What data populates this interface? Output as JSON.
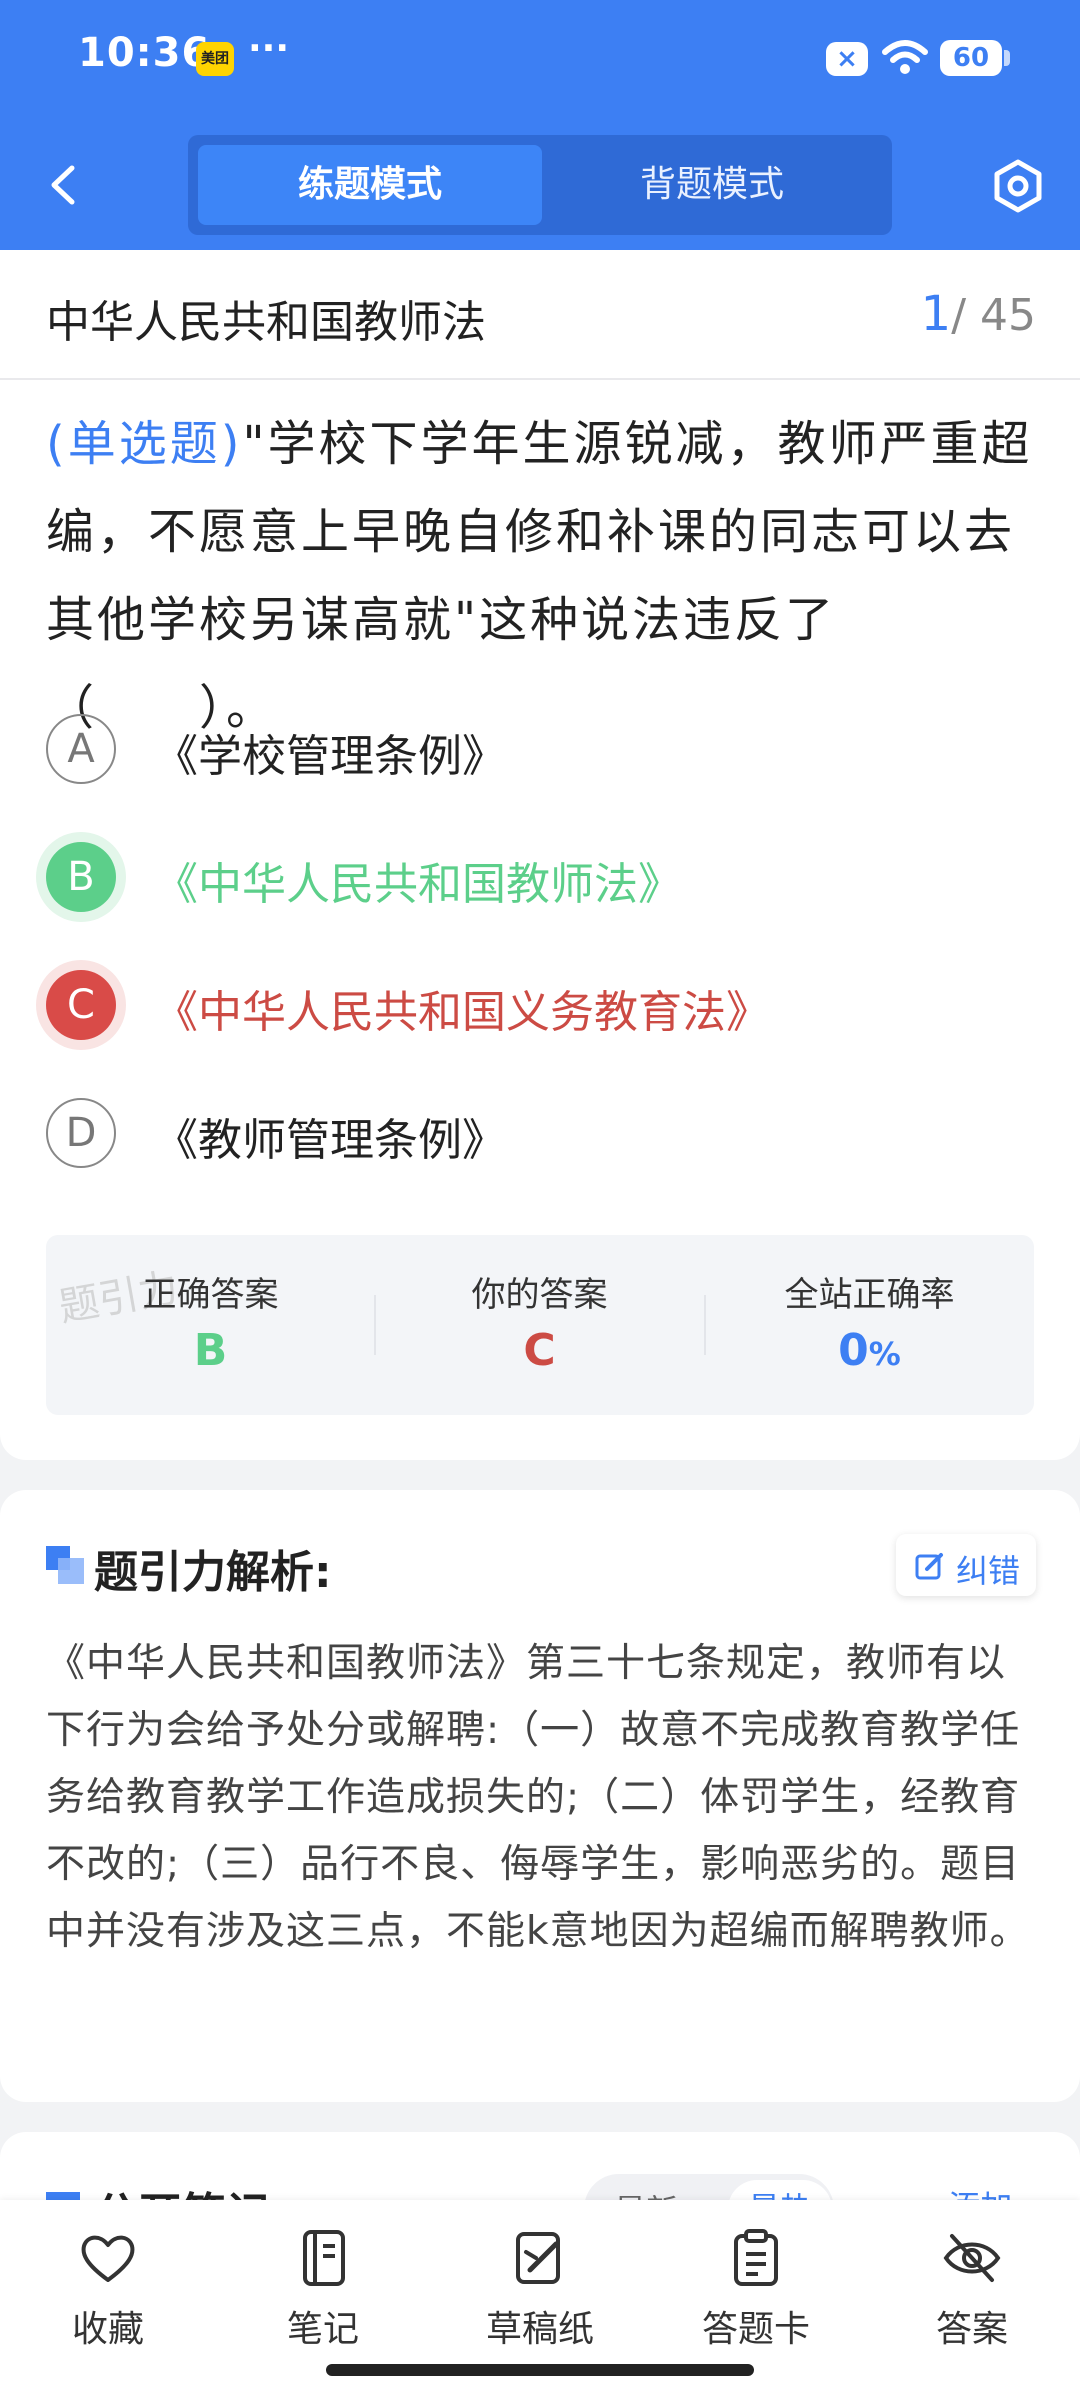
{
  "status_bar": {
    "time": "10:36",
    "app_badge": "美团",
    "more": "···",
    "battery": "60"
  },
  "header": {
    "modes": [
      "练题模式",
      "背题模式"
    ],
    "active_mode": "练题模式"
  },
  "question_card": {
    "doc_title": "中华人民共和国教师法",
    "current": "1",
    "total": "/ 45",
    "question_type": "(单选题)",
    "question_text": "\"学校下学年生源锐减，教师严重超编，不愿意上早晚自修和补课的同志可以去其他学校另谋高就\"这种说法违反了（　　）。",
    "options": [
      {
        "letter": "A",
        "text": "《学校管理条例》",
        "state": "normal"
      },
      {
        "letter": "B",
        "text": "《中华人民共和国教师法》",
        "state": "correct"
      },
      {
        "letter": "C",
        "text": "《中华人民共和国义务教育法》",
        "state": "wrong"
      },
      {
        "letter": "D",
        "text": "《教师管理条例》",
        "state": "normal"
      }
    ],
    "answer_summary": {
      "watermark": "题引力",
      "correct_label": "正确答案",
      "correct_value": "B",
      "yours_label": "你的答案",
      "yours_value": "C",
      "rate_label": "全站正确率",
      "rate_value": "0",
      "rate_unit": "%"
    }
  },
  "analysis": {
    "title": "题引力解析:",
    "correction_label": "纠错",
    "body": "《中华人民共和国教师法》第三十七条规定，教师有以下行为会给予处分或解聘:（一）故意不完成教育教学任务给教育教学工作造成损失的;（二）体罚学生，经教育不改的;（三）品行不良、侮辱学生，影响恶劣的。题目中并没有涉及这三点，不能k意地因为超编而解聘教师。"
  },
  "notes_card": {
    "title": "公开笔记:",
    "tabs": [
      "最新",
      "最热"
    ],
    "add_label": "添加"
  },
  "tabbar": {
    "items": [
      {
        "label": "收藏",
        "icon": "heart-icon"
      },
      {
        "label": "笔记",
        "icon": "notebook-icon"
      },
      {
        "label": "草稿纸",
        "icon": "draft-pen-icon"
      },
      {
        "label": "答题卡",
        "icon": "clipboard-icon"
      },
      {
        "label": "答案",
        "icon": "eye-off-icon"
      }
    ]
  },
  "colors": {
    "primary": "#3d7ff3",
    "correct": "#5ccf8a",
    "wrong": "#cc4b44"
  }
}
